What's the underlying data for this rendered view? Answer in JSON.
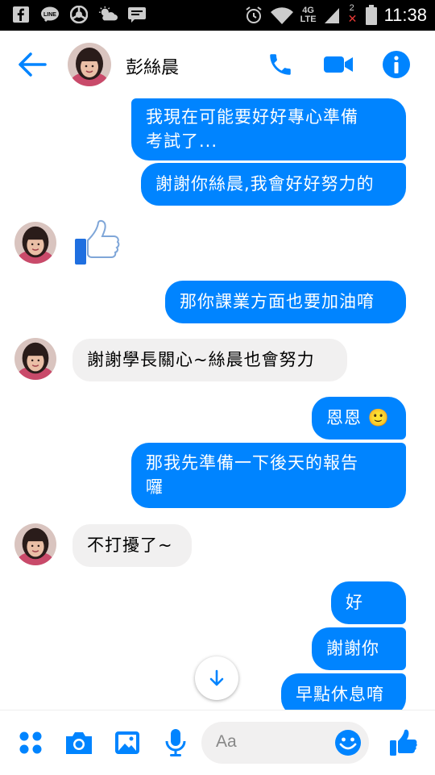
{
  "status_bar": {
    "time": "11:38",
    "network": "4G",
    "network_sub": "LTE",
    "notif_count": "2"
  },
  "header": {
    "contact_name": "彭絲晨"
  },
  "messages": [
    {
      "from": "me",
      "text_l1": "我現在可能要好好專心準備",
      "text_l2": "考試了..."
    },
    {
      "from": "me",
      "text": "謝謝你絲晨,我會好好努力的"
    },
    {
      "from": "them",
      "kind": "like-sticker"
    },
    {
      "from": "me",
      "text": "那你課業方面也要加油唷"
    },
    {
      "from": "them",
      "text": "謝謝學長關心~絲晨也會努力"
    },
    {
      "from": "me",
      "text": "恩恩 🙂"
    },
    {
      "from": "me",
      "text_l1": "那我先準備一下後天的報告",
      "text_l2": "囉"
    },
    {
      "from": "them",
      "text": "不打擾了~"
    },
    {
      "from": "me",
      "text": "好~~"
    },
    {
      "from": "me",
      "text": "謝謝你"
    },
    {
      "from": "me",
      "text": "早點休息唷"
    }
  ],
  "composer": {
    "placeholder": "Aa"
  },
  "colors": {
    "accent": "#0084ff",
    "incoming_bubble": "#f1f0f0",
    "status_bar": "#000000"
  },
  "icons": [
    "facebook-icon",
    "line-icon",
    "chrome-icon",
    "weather-icon",
    "messenger-icon",
    "alarm-icon",
    "wifi-icon",
    "signal-icon",
    "battery-icon",
    "back-arrow-icon",
    "phone-icon",
    "video-icon",
    "info-icon",
    "like-sticker-icon",
    "scroll-down-icon",
    "apps-grid-icon",
    "camera-icon",
    "gallery-icon",
    "microphone-icon",
    "emoji-icon",
    "like-icon"
  ]
}
